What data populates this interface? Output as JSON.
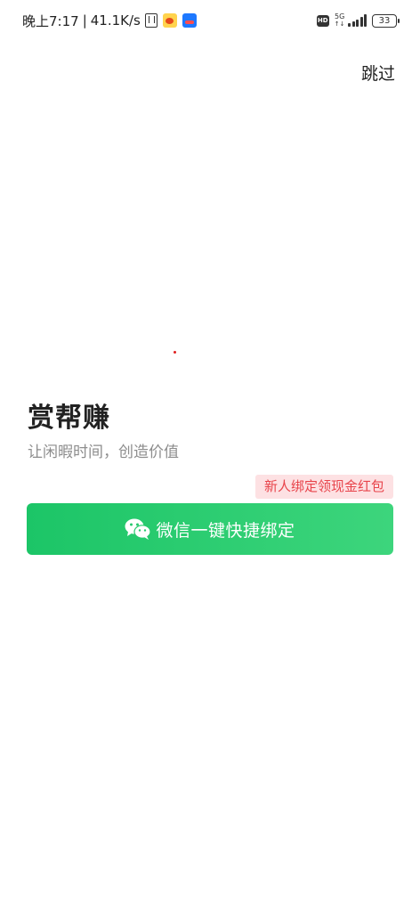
{
  "status_bar": {
    "time": "晚上7:17",
    "separator": "|",
    "speed": "41.1K/s",
    "hd": "HD",
    "network": "5G",
    "network_arrows": "↑↓",
    "battery": "33",
    "icons": [
      "nfc-icon",
      "weibo-icon",
      "alipay-icon",
      "hd-icon",
      "signal-icon",
      "battery-icon"
    ]
  },
  "header": {
    "skip_label": "跳过"
  },
  "main": {
    "app_name": "赏帮赚",
    "slogan": "让闲暇时间，创造价值",
    "promo_badge": "新人绑定领现金红包",
    "bind_button_label": "微信一键快捷绑定",
    "bind_button_icon": "wechat-icon"
  },
  "colors": {
    "button_start": "#1cc567",
    "button_end": "#3dd57c",
    "promo_bg": "#fde1e3",
    "promo_text": "#e8444b",
    "subtitle": "#8d8d8d"
  }
}
